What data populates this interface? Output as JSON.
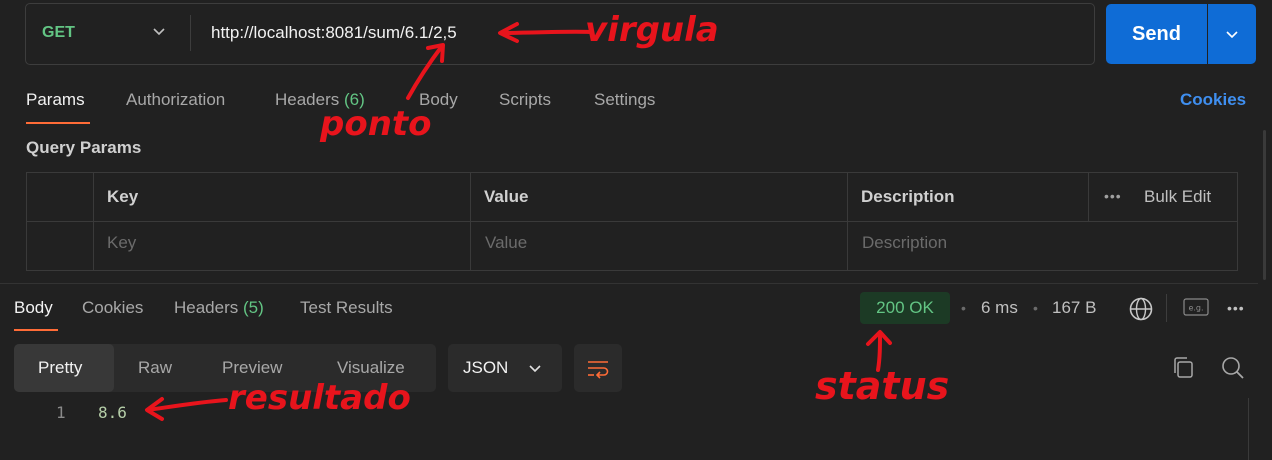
{
  "request": {
    "method": "GET",
    "url": "http://localhost:8081/sum/6.1/2,5",
    "send_label": "Send"
  },
  "request_tabs": {
    "params": "Params",
    "authorization": "Authorization",
    "headers_label": "Headers",
    "headers_count": "(6)",
    "body": "Body",
    "scripts": "Scripts",
    "settings": "Settings",
    "cookies": "Cookies"
  },
  "query_params": {
    "title": "Query Params",
    "columns": [
      "Key",
      "Value",
      "Description"
    ],
    "placeholders": [
      "Key",
      "Value",
      "Description"
    ],
    "bulk_edit": "Bulk Edit"
  },
  "response_tabs": {
    "body": "Body",
    "cookies": "Cookies",
    "headers_label": "Headers",
    "headers_count": "(5)",
    "test_results": "Test Results"
  },
  "response_meta": {
    "status": "200 OK",
    "time": "6 ms",
    "size": "167 B"
  },
  "format_bar": {
    "modes": [
      "Pretty",
      "Raw",
      "Preview",
      "Visualize"
    ],
    "active_mode": "Pretty",
    "language": "JSON"
  },
  "response_body": {
    "line_number": "1",
    "value": "8.6"
  },
  "annotations": {
    "virgula": "virgula",
    "ponto": "ponto",
    "resultado": "resultado",
    "status": "status"
  },
  "colors": {
    "accent": "#ff6c37",
    "send": "#0f6cd6",
    "method": "#63c584",
    "annotation": "#e8141c"
  },
  "icons": [
    "chevron-down-icon",
    "more-horizontal-icon",
    "globe-icon",
    "example-icon",
    "wrap-lines-icon",
    "copy-icon",
    "search-icon"
  ]
}
